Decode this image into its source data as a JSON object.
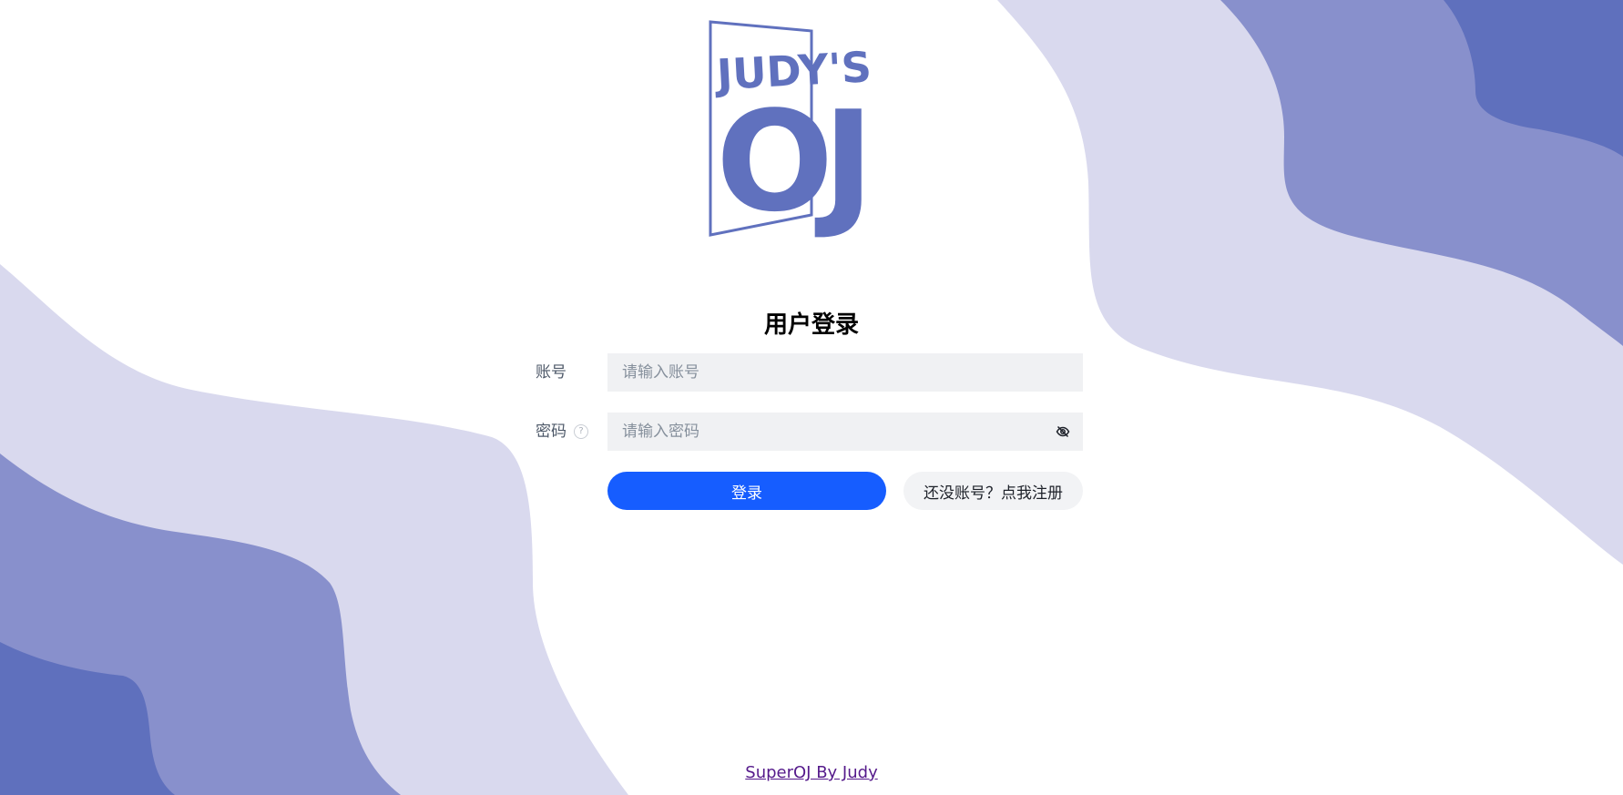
{
  "logo": {
    "line1": "JUDY'S",
    "line2": "OJ",
    "color": "#6071be"
  },
  "login": {
    "title": "用户登录",
    "account_label": "账号",
    "account_placeholder": "请输入账号",
    "password_label": "密码",
    "password_placeholder": "请输入密码",
    "help_icon": "question-circle-icon",
    "visibility_icon": "eye-off-icon",
    "login_button": "登录",
    "register_button": "还没账号？点我注册"
  },
  "footer": {
    "link_text": "SuperOJ By Judy"
  },
  "colors": {
    "primary": "#165dff",
    "wave_light": "#d9d9ee",
    "wave_mid": "#8890cc",
    "wave_dark": "#5f70bd",
    "input_bg": "#f0f1f3",
    "secondary_button_bg": "#f2f3f5"
  }
}
